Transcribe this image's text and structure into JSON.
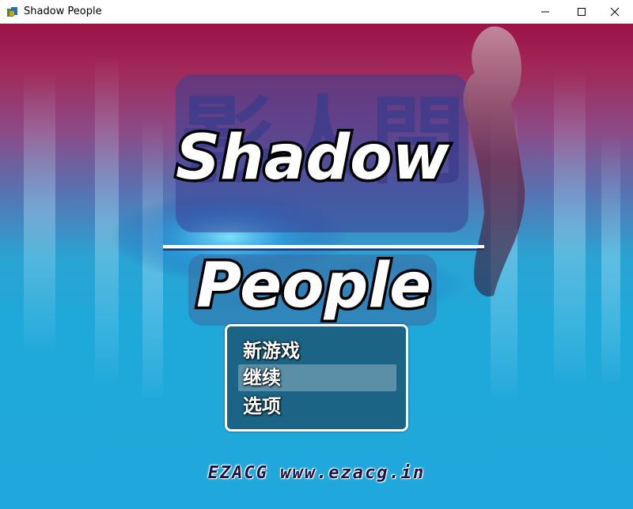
{
  "window": {
    "title": "Shadow People",
    "icon": "game-app-icon",
    "controls": [
      "minimize-icon",
      "maximize-icon",
      "close-icon"
    ]
  },
  "title_screen": {
    "title_line1": "Shadow",
    "title_line2": "People",
    "background_kanji": "影人間"
  },
  "menu": {
    "items": [
      {
        "label": "新游戏",
        "selected": false
      },
      {
        "label": "继续",
        "selected": true
      },
      {
        "label": "选项",
        "selected": false
      }
    ]
  },
  "watermark": "EZACG www.ezacg.in",
  "colors": {
    "sky_top": "#9b1244",
    "sky_bottom": "#20a8dc",
    "menu_border": "#ffffff",
    "watermark": "#1a1450"
  }
}
